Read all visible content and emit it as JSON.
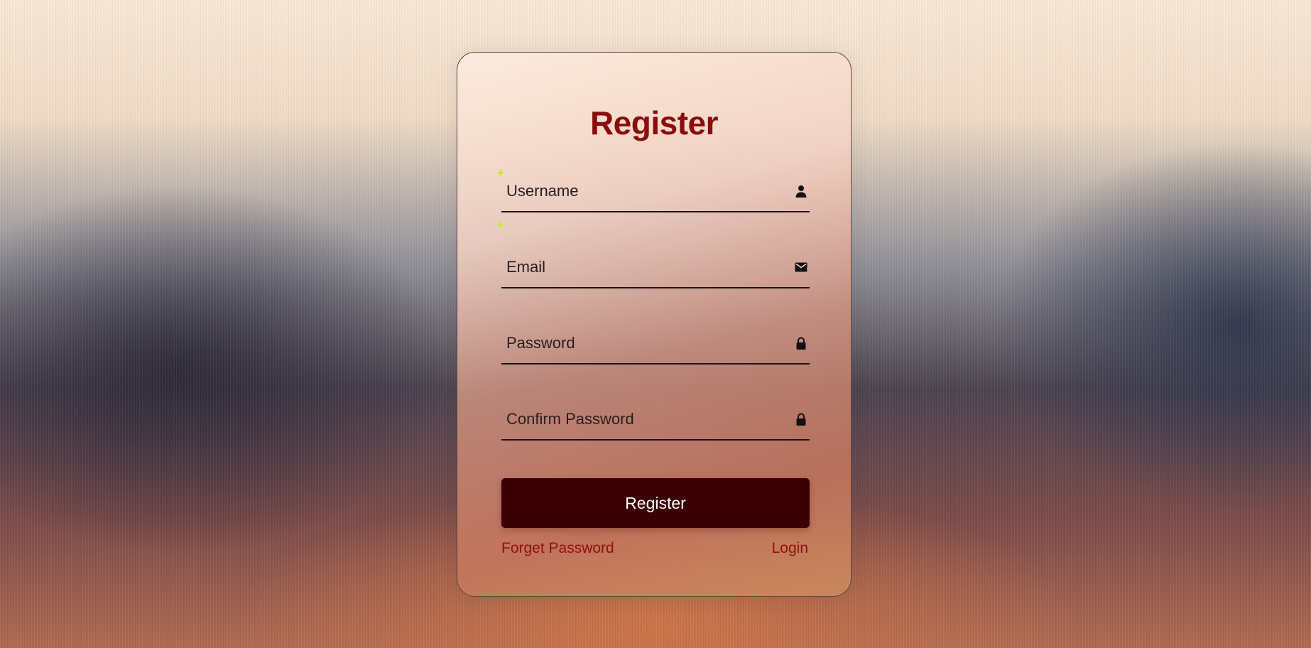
{
  "form": {
    "title": "Register",
    "username_placeholder": "Username",
    "email_placeholder": "Email",
    "password_placeholder": "Password",
    "confirm_placeholder": "Confirm Password",
    "submit_label": "Register",
    "forget_label": "Forget Password",
    "login_label": "Login"
  },
  "icons": {
    "username": "user-icon",
    "email": "envelope-icon",
    "password": "lock-icon",
    "confirm": "lock-icon"
  },
  "colors": {
    "title": "#8a0c0c",
    "button": "#3b0003",
    "link": "#8f1010",
    "spark": "#c8e83a"
  }
}
